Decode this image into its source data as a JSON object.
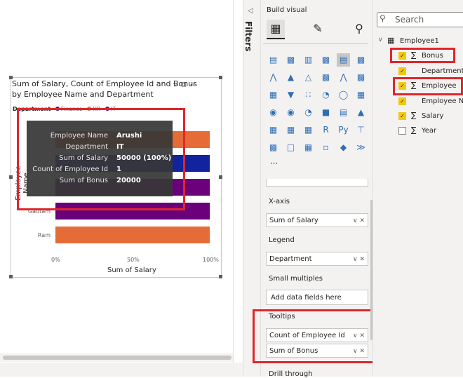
{
  "visual": {
    "title": "Sum of Salary, Count of Employee Id and Bonus by Employee Name and Department",
    "legend_title": "Department",
    "legend_items": [
      {
        "label": "Finance",
        "color": "#12239e"
      },
      {
        "label": "HR",
        "color": "#e66c37"
      },
      {
        "label": "IT",
        "color": "#6b007b"
      }
    ],
    "y_axis_title": "Employee Name",
    "x_axis_title": "Sum of Salary",
    "x_ticks": [
      "0%",
      "50%",
      "100%"
    ],
    "visible_category_labels": [
      "Gautam",
      "Ram"
    ],
    "icons": {
      "filter": "filter-icon",
      "focus": "focus-mode-icon",
      "more": "more-options-icon"
    }
  },
  "chart_data": {
    "type": "bar",
    "orientation": "horizontal",
    "stacking": "100%",
    "title": "Sum of Salary, Count of Employee Id and Bonus by Employee Name and Department",
    "xlabel": "Sum of Salary",
    "ylabel": "Employee Name",
    "xlim": [
      0,
      100
    ],
    "x_ticks": [
      "0%",
      "50%",
      "100%"
    ],
    "categories": [
      "",
      "",
      "",
      "Gautam",
      "Ram"
    ],
    "bar_colors": [
      "#e66c37",
      "#12239e",
      "#6b007b",
      "#6b007b",
      "#e66c37"
    ],
    "values": [
      100,
      100,
      100,
      100,
      100
    ],
    "legend": {
      "title": "Department",
      "items": [
        "Finance",
        "HR",
        "IT"
      ],
      "placement": "top-left"
    }
  },
  "tooltip": {
    "rows": [
      {
        "label": "Employee Name",
        "value": "Arushi"
      },
      {
        "label": "Department",
        "value": "IT"
      },
      {
        "label": "Sum of Salary",
        "value": "50000 (100%)"
      },
      {
        "label": "Count of Employee Id",
        "value": "1"
      },
      {
        "label": "Sum of Bonus",
        "value": "20000"
      }
    ]
  },
  "filters_pane": {
    "label": "Filters"
  },
  "viz_pane": {
    "title": "Build visual",
    "wells": {
      "x_axis": {
        "heading": "X-axis",
        "field": "Sum of Salary"
      },
      "legend": {
        "heading": "Legend",
        "field": "Department"
      },
      "small_multiples": {
        "heading": "Small multiples",
        "placeholder": "Add data fields here"
      },
      "tooltips": {
        "heading": "Tooltips",
        "fields": [
          "Count of Employee Id",
          "Sum of Bonus"
        ]
      },
      "drill_through": {
        "heading": "Drill through"
      }
    },
    "more_label": "···"
  },
  "fields_pane": {
    "search_placeholder": "Search",
    "table_name": "Employee1",
    "fields": [
      {
        "name": "Bonus",
        "checked": true,
        "sigma": true
      },
      {
        "name": "Department",
        "checked": true,
        "sigma": false
      },
      {
        "name": "Employee Id",
        "checked": true,
        "sigma": true
      },
      {
        "name": "Employee Name",
        "checked": true,
        "sigma": false
      },
      {
        "name": "Salary",
        "checked": true,
        "sigma": true
      },
      {
        "name": "Year",
        "checked": false,
        "sigma": true
      }
    ]
  },
  "colors": {
    "highlight_red": "#e0262b",
    "accent_yellow": "#f2c811"
  }
}
